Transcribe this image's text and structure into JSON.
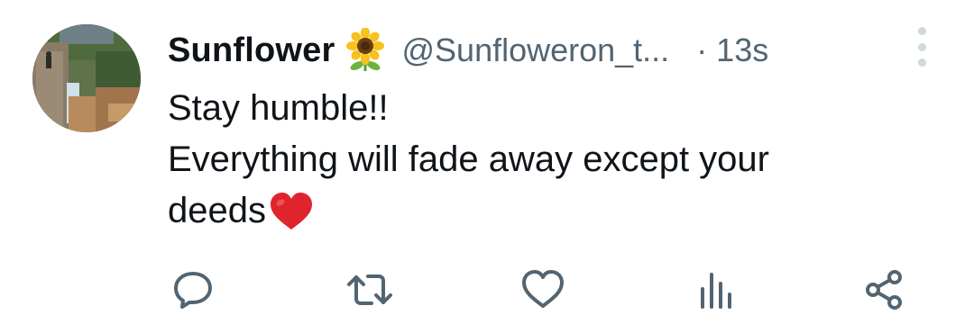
{
  "tweet": {
    "author": {
      "name": "Sunflower",
      "badge_emoji": "sunflower-emoji",
      "handle": "@Sunfloweron_t...",
      "avatar": "waterfall-photo-avatar"
    },
    "timestamp": "· 13s",
    "text": {
      "line1": "Stay humble!!",
      "line2": "Everything will fade away except your",
      "line3": "deeds",
      "end_emoji": "red-heart-emoji"
    },
    "actions": [
      {
        "name": "reply",
        "icon": "reply-icon"
      },
      {
        "name": "retweet",
        "icon": "retweet-icon"
      },
      {
        "name": "like",
        "icon": "heart-icon"
      },
      {
        "name": "views",
        "icon": "analytics-icon"
      },
      {
        "name": "share",
        "icon": "share-icon"
      }
    ]
  },
  "colors": {
    "text_primary": "#0f1419",
    "text_secondary": "#536471",
    "heart_emoji": "#e0242e",
    "more_dots": "#cfd9de"
  }
}
